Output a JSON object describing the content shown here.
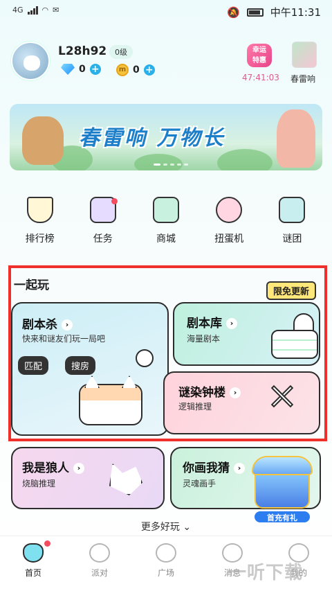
{
  "status": {
    "network": "4G",
    "time": "中午11:31"
  },
  "profile": {
    "username": "L28h92",
    "level": "0级",
    "diamonds": "0",
    "coins": "0"
  },
  "promo": {
    "badge_line1": "幸运",
    "badge_line2": "特惠",
    "countdown": "47:41:03",
    "event_label": "春雷响"
  },
  "banner": {
    "title": "春雷响 万物长",
    "slide_count": 5,
    "active_slide": 1
  },
  "quick_nav": [
    {
      "label": "排行榜",
      "icon": "trophy-icon"
    },
    {
      "label": "任务",
      "icon": "calendar-icon"
    },
    {
      "label": "商城",
      "icon": "shop-icon"
    },
    {
      "label": "扭蛋机",
      "icon": "gacha-icon"
    },
    {
      "label": "谜团",
      "icon": "flag-icon"
    }
  ],
  "section": {
    "title": "一起玩",
    "tag": "限免更新"
  },
  "cards": {
    "murder_mystery": {
      "title": "剧本杀",
      "subtitle": "快来和谜友们玩一局吧",
      "btn_match": "匹配",
      "btn_search": "搜房"
    },
    "script_library": {
      "title": "剧本库",
      "subtitle": "海量剧本"
    },
    "bell_tower": {
      "title": "谜染钟楼",
      "subtitle": "逻辑推理"
    },
    "werewolf": {
      "title": "我是狼人",
      "subtitle": "烧脑推理"
    },
    "draw_guess": {
      "title": "你画我猜",
      "subtitle": "灵魂画手"
    }
  },
  "first_recharge": "首充有礼",
  "more_label": "更多好玩",
  "bottom_nav": [
    {
      "label": "首页",
      "icon": "home-cat-icon",
      "active": true
    },
    {
      "label": "派对",
      "icon": "heart-icon",
      "active": false
    },
    {
      "label": "广场",
      "icon": "planet-icon",
      "active": false
    },
    {
      "label": "消息",
      "icon": "message-icon",
      "active": false
    },
    {
      "label": "我的",
      "icon": "profile-icon",
      "active": false
    }
  ],
  "watermark": "一听下载",
  "colors": {
    "accent": "#2ab0e8",
    "highlight_frame": "#ef2f2a",
    "notification": "#f44d5f",
    "promo": "#e8448a"
  }
}
